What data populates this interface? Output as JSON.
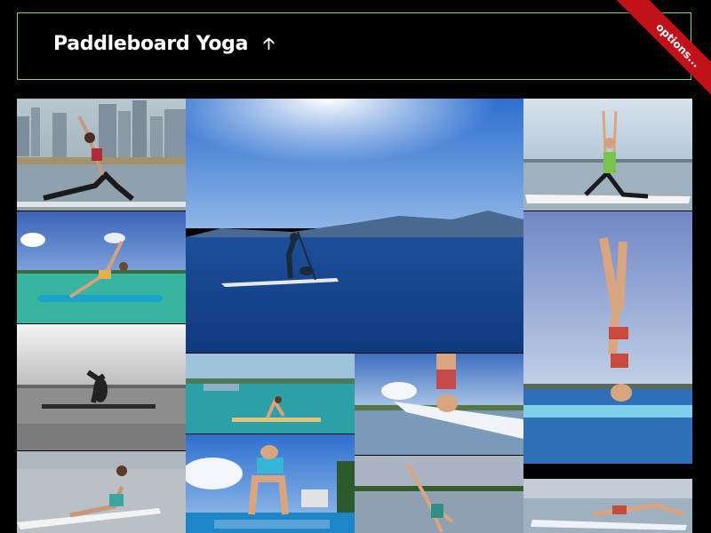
{
  "page": {
    "title": "Paddleboard Yoga",
    "ribbon_label": "options..."
  },
  "tiles": [
    {
      "name": "photo-city-lunge",
      "icon": "photo-icon"
    },
    {
      "name": "photo-center-paddler",
      "icon": "photo-icon"
    },
    {
      "name": "photo-arms-up-lunge",
      "icon": "photo-icon"
    },
    {
      "name": "photo-side-plank",
      "icon": "photo-icon"
    },
    {
      "name": "photo-bw-headstand",
      "icon": "photo-icon"
    },
    {
      "name": "photo-turquoise-pose",
      "icon": "photo-icon"
    },
    {
      "name": "photo-headstand-closeup",
      "icon": "photo-icon"
    },
    {
      "name": "photo-tall-headstand",
      "icon": "photo-icon"
    },
    {
      "name": "photo-bw-seated",
      "icon": "photo-icon"
    },
    {
      "name": "photo-backbend",
      "icon": "photo-icon"
    },
    {
      "name": "photo-cartwheel",
      "icon": "photo-icon"
    },
    {
      "name": "photo-plank",
      "icon": "photo-icon"
    }
  ],
  "colors": {
    "header_border": "#8fd46a",
    "ribbon": "#c1121b"
  }
}
